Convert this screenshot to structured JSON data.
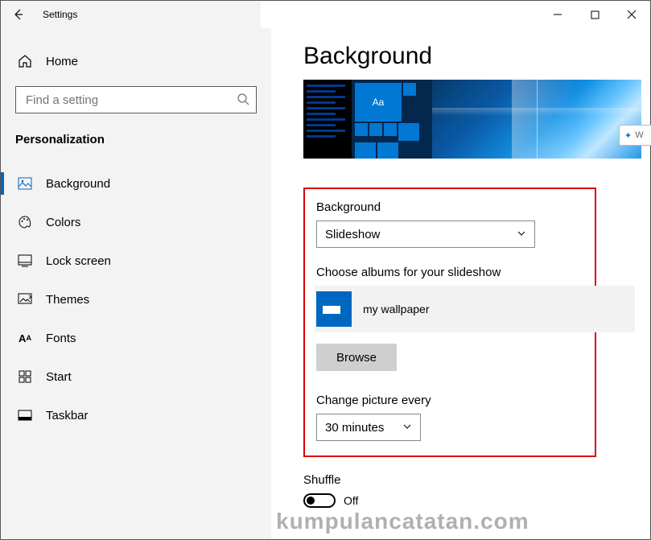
{
  "titlebar": {
    "title": "Settings"
  },
  "sidebar": {
    "home_label": "Home",
    "search_placeholder": "Find a setting",
    "section_label": "Personalization",
    "items": [
      {
        "label": "Background"
      },
      {
        "label": "Colors"
      },
      {
        "label": "Lock screen"
      },
      {
        "label": "Themes"
      },
      {
        "label": "Fonts"
      },
      {
        "label": "Start"
      },
      {
        "label": "Taskbar"
      }
    ]
  },
  "main": {
    "page_title": "Background",
    "preview_tile_text": "Aa",
    "side_tab_text": "W",
    "background_label": "Background",
    "background_value": "Slideshow",
    "albums_label": "Choose albums for your slideshow",
    "album_name": "my wallpaper",
    "browse_label": "Browse",
    "change_label": "Change picture every",
    "change_value": "30 minutes",
    "shuffle_label": "Shuffle",
    "shuffle_state": "Off"
  },
  "watermark": "kumpulancatatan.com"
}
